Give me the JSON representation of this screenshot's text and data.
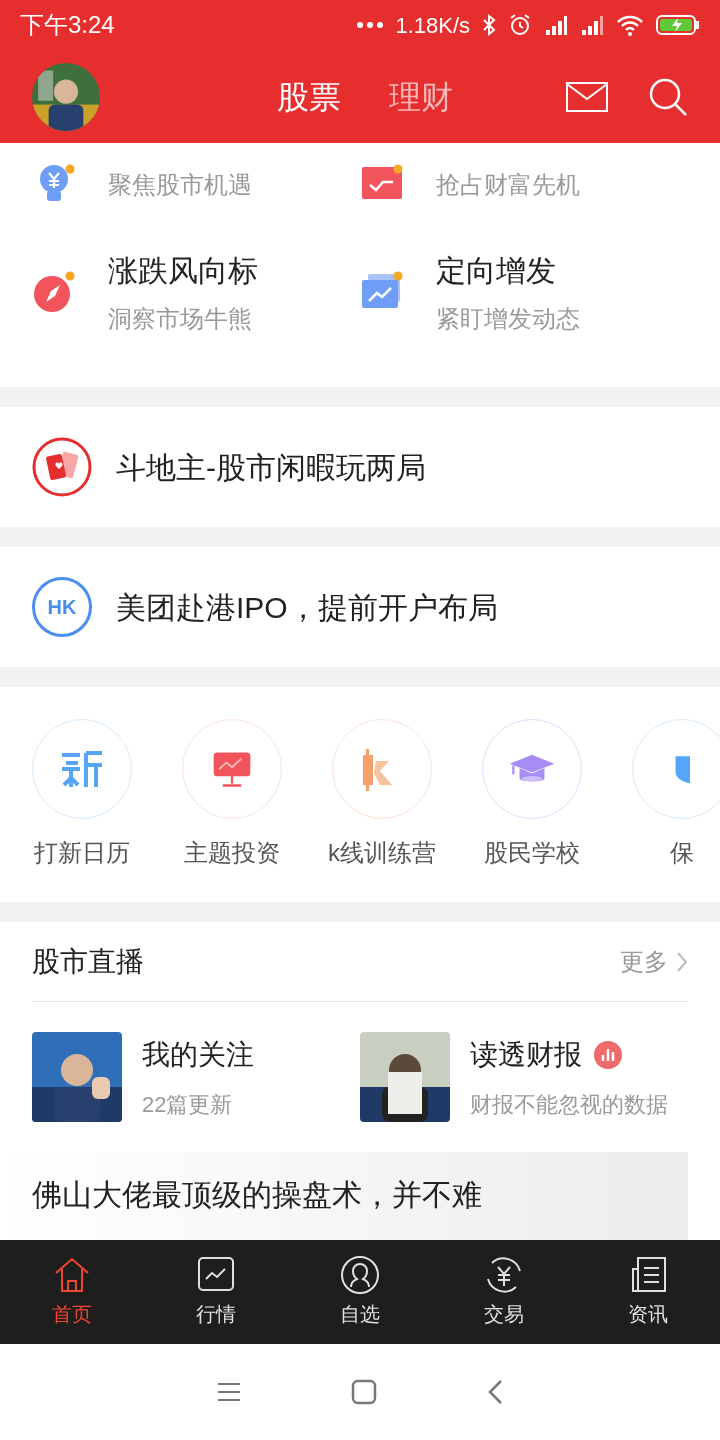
{
  "status_bar": {
    "time": "下午3:24",
    "net_speed": "1.18K/s"
  },
  "header": {
    "tabs": [
      {
        "label": "股票",
        "selected": true
      },
      {
        "label": "理财",
        "selected": false
      }
    ]
  },
  "features": [
    {
      "kind": "bulb",
      "subtitle": "聚焦股市机遇"
    },
    {
      "kind": "calendar",
      "subtitle": "抢占财富先机"
    },
    {
      "kind": "compass",
      "title": "涨跌风向标",
      "subtitle": "洞察市场牛熊"
    },
    {
      "kind": "chart",
      "title": "定向增发",
      "subtitle": "紧盯增发动态"
    }
  ],
  "banners": [
    {
      "kind": "cards",
      "text": "斗地主-股市闲暇玩两局"
    },
    {
      "kind": "hk",
      "icon_text": "HK",
      "text": "美团赴港IPO，提前开户布局"
    }
  ],
  "shortcuts": [
    {
      "kind": "new",
      "label": "打新日历"
    },
    {
      "kind": "board",
      "label": "主题投资"
    },
    {
      "kind": "k",
      "label": "k线训练营"
    },
    {
      "kind": "cap",
      "label": "股民学校"
    },
    {
      "kind": "shield",
      "label": "保"
    }
  ],
  "live": {
    "title": "股市直播",
    "more": "更多",
    "columns": [
      {
        "title": "我的关注",
        "subtitle": "22篇更新",
        "badge": false
      },
      {
        "title": "读透财报",
        "subtitle": "财报不能忽视的数据",
        "badge": true
      }
    ],
    "article": "佛山大佬最顶级的操盘术，并不难"
  },
  "bottom_nav": [
    {
      "kind": "home",
      "label": "首页",
      "selected": true
    },
    {
      "kind": "market",
      "label": "行情",
      "selected": false
    },
    {
      "kind": "watch",
      "label": "自选",
      "selected": false
    },
    {
      "kind": "trade",
      "label": "交易",
      "selected": false
    },
    {
      "kind": "news",
      "label": "资讯",
      "selected": false
    }
  ]
}
